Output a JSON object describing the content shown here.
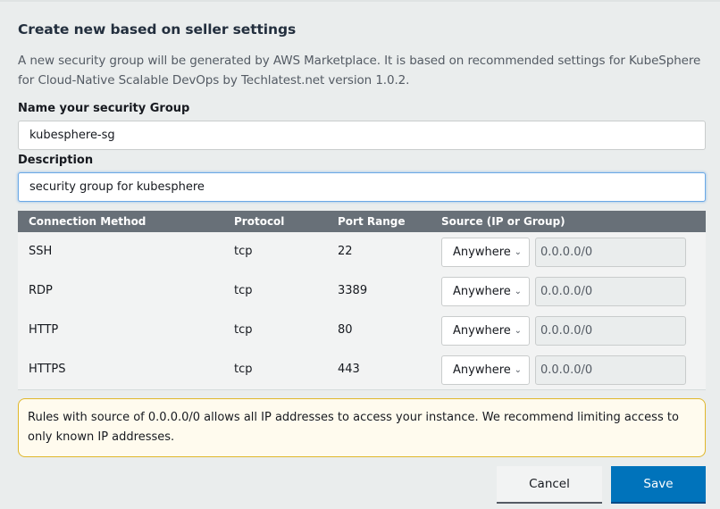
{
  "heading": "Create new based on seller settings",
  "description": "A new security group will be generated by AWS Marketplace. It is based on recommended settings for KubeSphere for Cloud-Native Scalable DevOps by Techlatest.net version 1.0.2.",
  "name_field": {
    "label": "Name your security Group",
    "value": "kubesphere-sg"
  },
  "description_field": {
    "label": "Description",
    "value": "security group for kubesphere"
  },
  "rules_table": {
    "columns": [
      "Connection Method",
      "Protocol",
      "Port Range",
      "Source (IP or Group)"
    ],
    "rows": [
      {
        "method": "SSH",
        "protocol": "tcp",
        "port": "22",
        "source": "Anywhere",
        "ip": "0.0.0.0/0"
      },
      {
        "method": "RDP",
        "protocol": "tcp",
        "port": "3389",
        "source": "Anywhere",
        "ip": "0.0.0.0/0"
      },
      {
        "method": "HTTP",
        "protocol": "tcp",
        "port": "80",
        "source": "Anywhere",
        "ip": "0.0.0.0/0"
      },
      {
        "method": "HTTPS",
        "protocol": "tcp",
        "port": "443",
        "source": "Anywhere",
        "ip": "0.0.0.0/0"
      }
    ]
  },
  "icons": {
    "dropdown": "chevron-down-icon"
  },
  "warning": "Rules with source of 0.0.0.0/0 allows all IP addresses to access your instance. We recommend limiting access to only known IP addresses.",
  "buttons": {
    "cancel": "Cancel",
    "save": "Save"
  },
  "colors": {
    "primary": "#0073bb",
    "table_header": "#687078",
    "warning_border": "#e0b72b",
    "warning_bg": "#fffbee"
  }
}
